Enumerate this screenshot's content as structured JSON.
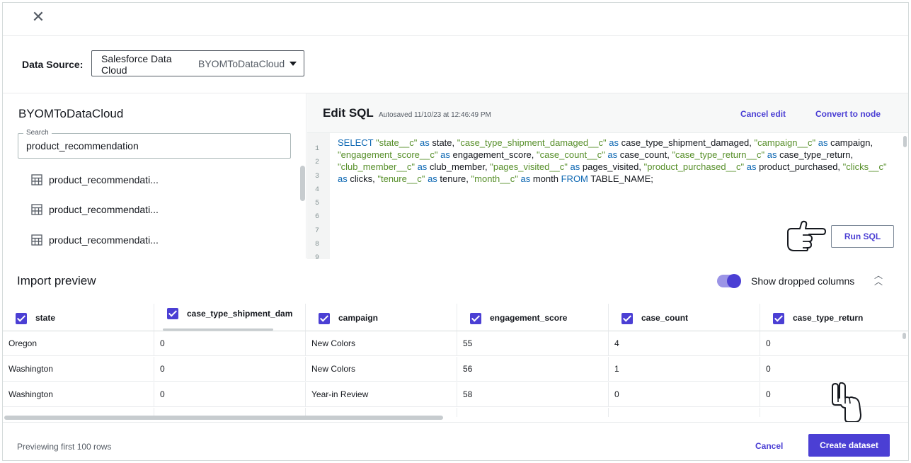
{
  "header": {
    "close_icon": "close-icon"
  },
  "data_source": {
    "label": "Data Source:",
    "selected_type": "Salesforce Data Cloud",
    "selected_value": "BYOMToDataCloud"
  },
  "left_panel": {
    "title": "BYOMToDataCloud",
    "search": {
      "legend": "Search",
      "value": "product_recommendation"
    },
    "tables": [
      "product_recommendati...",
      "product_recommendati...",
      "product_recommendati..."
    ]
  },
  "sql_editor": {
    "title": "Edit SQL",
    "autosave": "Autosaved 11/10/23 at 12:46:49 PM",
    "cancel_edit": "Cancel edit",
    "convert_to_node": "Convert to node",
    "run_sql": "Run SQL",
    "line_numbers": [
      "1",
      "2",
      "3",
      "4",
      "5",
      "6",
      "7",
      "8",
      "9"
    ],
    "query": {
      "select": "SELECT",
      "as": "as",
      "from": "FROM",
      "table": "TABLE_NAME;",
      "fields": [
        {
          "src": "\"state__c\"",
          "alias": "state"
        },
        {
          "src": "\"case_type_shipment_damaged__c\"",
          "alias": "case_type_shipment_damaged"
        },
        {
          "src": "\"campaign__c\"",
          "alias": "campaign"
        },
        {
          "src": "\"engagement_score__c\"",
          "alias": "engagement_score"
        },
        {
          "src": "\"case_count__c\"",
          "alias": "case_count"
        },
        {
          "src": "\"case_type_return__c\"",
          "alias": "case_type_return"
        },
        {
          "src": "\"club_member__c\"",
          "alias": "club_member"
        },
        {
          "src": "\"pages_visited__c\"",
          "alias": "pages_visited"
        },
        {
          "src": "\"product_purchased__c\"",
          "alias": "product_purchased"
        },
        {
          "src": "\"clicks__c\"",
          "alias": "clicks"
        },
        {
          "src": "\"tenure__c\"",
          "alias": "tenure"
        },
        {
          "src": "\"month__c\"",
          "alias": "month"
        }
      ]
    }
  },
  "import_preview": {
    "title": "Import preview",
    "show_dropped_label": "Show dropped columns",
    "show_dropped_on": true,
    "columns": [
      "state",
      "case_type_shipment_dam",
      "campaign",
      "engagement_score",
      "case_count",
      "case_type_return"
    ],
    "rows": [
      [
        "Oregon",
        "0",
        "New Colors",
        "55",
        "4",
        "0"
      ],
      [
        "Washington",
        "0",
        "New Colors",
        "56",
        "1",
        "0"
      ],
      [
        "Washington",
        "0",
        "Year-in Review",
        "58",
        "0",
        "0"
      ]
    ]
  },
  "footer": {
    "note": "Previewing first 100 rows",
    "cancel": "Cancel",
    "create": "Create dataset"
  },
  "colors": {
    "accent": "#4b3fd4",
    "keyword": "#0b66b2",
    "string": "#578f2a"
  }
}
